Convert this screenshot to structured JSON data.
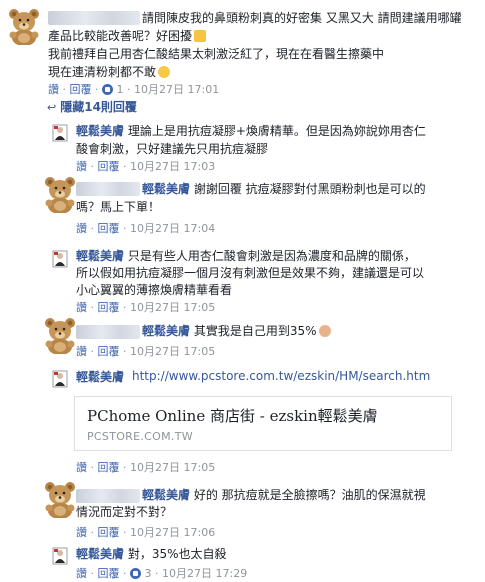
{
  "top_comment": {
    "text_l1": "請問陳皮我的鼻頭粉刺真的好密集 又黑又大 請問建議用哪罐",
    "text_l2": "產品比較能改善呢？好困擾",
    "text_l3": "我前禮拜自己用杏仁酸結果太刺激泛紅了，現在在看醫生擦藥中",
    "text_l4": "現在連清粉刺都不敢",
    "actions": {
      "like": "讚",
      "reply": "回覆",
      "count": "1",
      "time": "10月27日 17:01"
    }
  },
  "hidden_replies_label": "隱藏14則回覆",
  "replies": [
    {
      "author": "輕鬆美膚",
      "l1": "理論上是用抗痘凝膠+煥膚精華。但是因為妳說妳用杏仁",
      "l2": "酸會刺激，只好建議先只用抗痘凝膠",
      "time": "10月27日 17:03"
    },
    {
      "author": "輕鬆美膚",
      "l1": "謝謝回覆 抗痘凝膠對付黑頭粉刺也是可以的",
      "l2": "嗎？馬上下單！",
      "time": "10月27日 17:04"
    },
    {
      "author": "輕鬆美膚",
      "l1": "只是有些人用杏仁酸會刺激是因為濃度和品牌的關係，",
      "l2": "所以假如用抗痘凝膠一個月沒有刺激但是效果不夠，建議還是可以",
      "l3": "小心翼翼的薄擦煥膚精華看看",
      "time": "10月27日 17:05"
    },
    {
      "author": "輕鬆美膚",
      "l1": "其實我是自己用到35%",
      "time": "10月27日 17:05"
    },
    {
      "author": "輕鬆美膚",
      "link": "http://www.pcstore.com.tw/ezskin/HM/search.htm",
      "preview_title": "PChome Online 商店街 - ezskin輕鬆美膚",
      "preview_domain": "PCSTORE.COM.TW",
      "time": "10月27日 17:05"
    },
    {
      "author": "輕鬆美膚",
      "l1": "好的 那抗痘就是全臉擦嗎？油肌的保濕就視",
      "l2": "情況而定對不對？",
      "time": "10月27日 17:06"
    },
    {
      "author": "輕鬆美膚",
      "l1": "對，35%也太自殺",
      "count": "3",
      "time": "10月27日 17:29"
    }
  ],
  "action_like": "讚",
  "action_reply": "回覆",
  "action_sep": "·",
  "colors": {
    "link": "#365899",
    "meta": "#90949c",
    "like": "#4267b2",
    "blur": "#cfd5df"
  },
  "icons": {
    "avatar_user": "teddy-bear-icon",
    "avatar_page": "page-logo-icon",
    "hidden_replies": "reply-arrow-icon",
    "like_count": "like-icon",
    "emoji_sad": "sad-face-icon",
    "emoji_blush": "blushing-face-icon",
    "emoji_tired": "tired-face-icon",
    "emoji_woman": "woman-tipping-hand-icon"
  }
}
